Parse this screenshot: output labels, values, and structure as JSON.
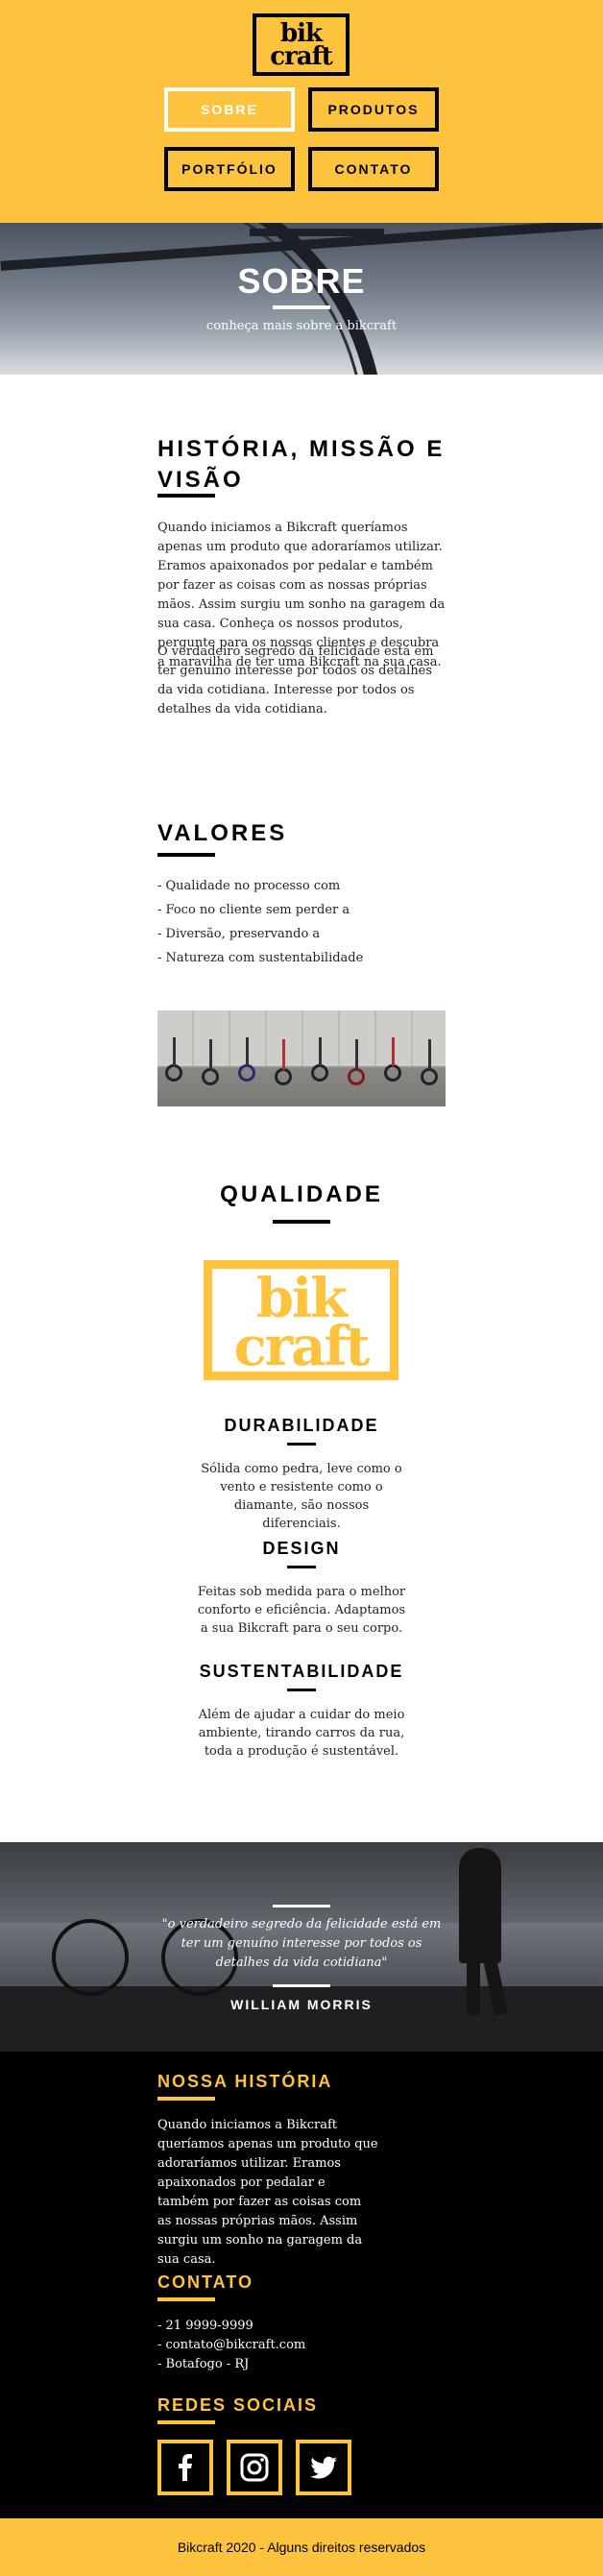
{
  "logo": {
    "line1": "bik",
    "line2": "craft"
  },
  "nav": [
    "SOBRE",
    "PRODUTOS",
    "PORTFÓLIO",
    "CONTATO"
  ],
  "hero": {
    "title": "SOBRE",
    "subtitle": "conheça mais sobre a bikcraft"
  },
  "historia": {
    "title_line1": "HISTÓRIA, MISSÃO E",
    "title_line2": "VISÃO",
    "p1": "Quando iniciamos a Bikcraft queríamos apenas um produto que adoraríamos utilizar. Eramos apaixonados por pedalar e também por fazer as coisas com as nossas próprias mãos. Assim surgiu um sonho na garagem da sua casa. Conheça os nossos produtos, pergunte para os nossos clientes e descubra a maravilha de ter uma Bikcraft na sua casa.",
    "p2": "O verdadeiro segredo da felicidade está em ter genuíno interesse por todos os detalhes da vida cotidiana. Interesse por todos os detalhes da vida cotidiana."
  },
  "valores": {
    "title": "VALORES",
    "items": [
      "- Qualidade no processo com",
      "- Foco no cliente sem perder a",
      "- Diversão, preservando a",
      "- Natureza com sustentabilidade"
    ]
  },
  "qualidade": {
    "title": "QUALIDADE",
    "logo_line1": "bik",
    "logo_line2": "craft",
    "features": [
      {
        "title": "DURABILIDADE",
        "text": "Sólida como pedra, leve como o vento e resistente como o diamante, são nossos diferenciais."
      },
      {
        "title": "DESIGN",
        "text": "Feitas sob medida para o melhor conforto e eficiência. Adaptamos a sua Bikcraft para o seu corpo."
      },
      {
        "title": "SUSTENTABILIDADE",
        "text": "Além de ajudar a cuidar do meio ambiente, tirando carros da rua, toda a produção é sustentável."
      }
    ]
  },
  "quote": {
    "text": "\"o verdadeiro segredo da felicidade está em ter um genuíno interesse por todos os detalhes da vida cotidiana\"",
    "author": "WILLIAM MORRIS"
  },
  "footer": {
    "historia_title": "NOSSA HISTÓRIA",
    "historia_text": "Quando iniciamos a Bikcraft queríamos apenas um produto que adoraríamos utilizar. Eramos apaixonados por pedalar e também por fazer as coisas com as nossas próprias mãos. Assim surgiu um sonho na garagem da sua casa.",
    "contato_title": "CONTATO",
    "contato": [
      "- 21 9999-9999",
      "- contato@bikcraft.com",
      "- Botafogo - RJ"
    ],
    "redes_title": "REDES SOCIAIS",
    "social_icons": [
      "facebook-icon",
      "instagram-icon",
      "twitter-icon"
    ],
    "copyright": "Bikcraft 2020 - Alguns direitos reservados"
  },
  "colors": {
    "brand_yellow": "#fec33d",
    "black": "#000000",
    "white": "#ffffff"
  }
}
